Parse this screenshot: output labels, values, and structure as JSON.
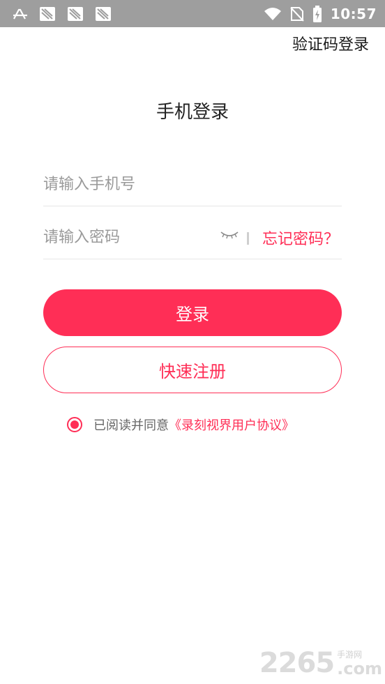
{
  "status_bar": {
    "time": "10:57"
  },
  "header": {
    "sms_login_label": "验证码登录"
  },
  "title": "手机登录",
  "phone_field": {
    "placeholder": "请输入手机号",
    "value": ""
  },
  "password_field": {
    "placeholder": "请输入密码",
    "value": "",
    "forgot_label": "忘记密码？"
  },
  "buttons": {
    "login_label": "登录",
    "register_label": "快速注册"
  },
  "agreement": {
    "checked": true,
    "text": "已阅读并同意",
    "link": "《录刻视界用户协议》"
  },
  "watermark": {
    "number": "2265",
    "site_cn": "手游网",
    "suffix": ".com"
  },
  "colors": {
    "accent": "#ff2e56",
    "status_bar": "#9e9e9e",
    "placeholder": "#9a9a9a"
  }
}
